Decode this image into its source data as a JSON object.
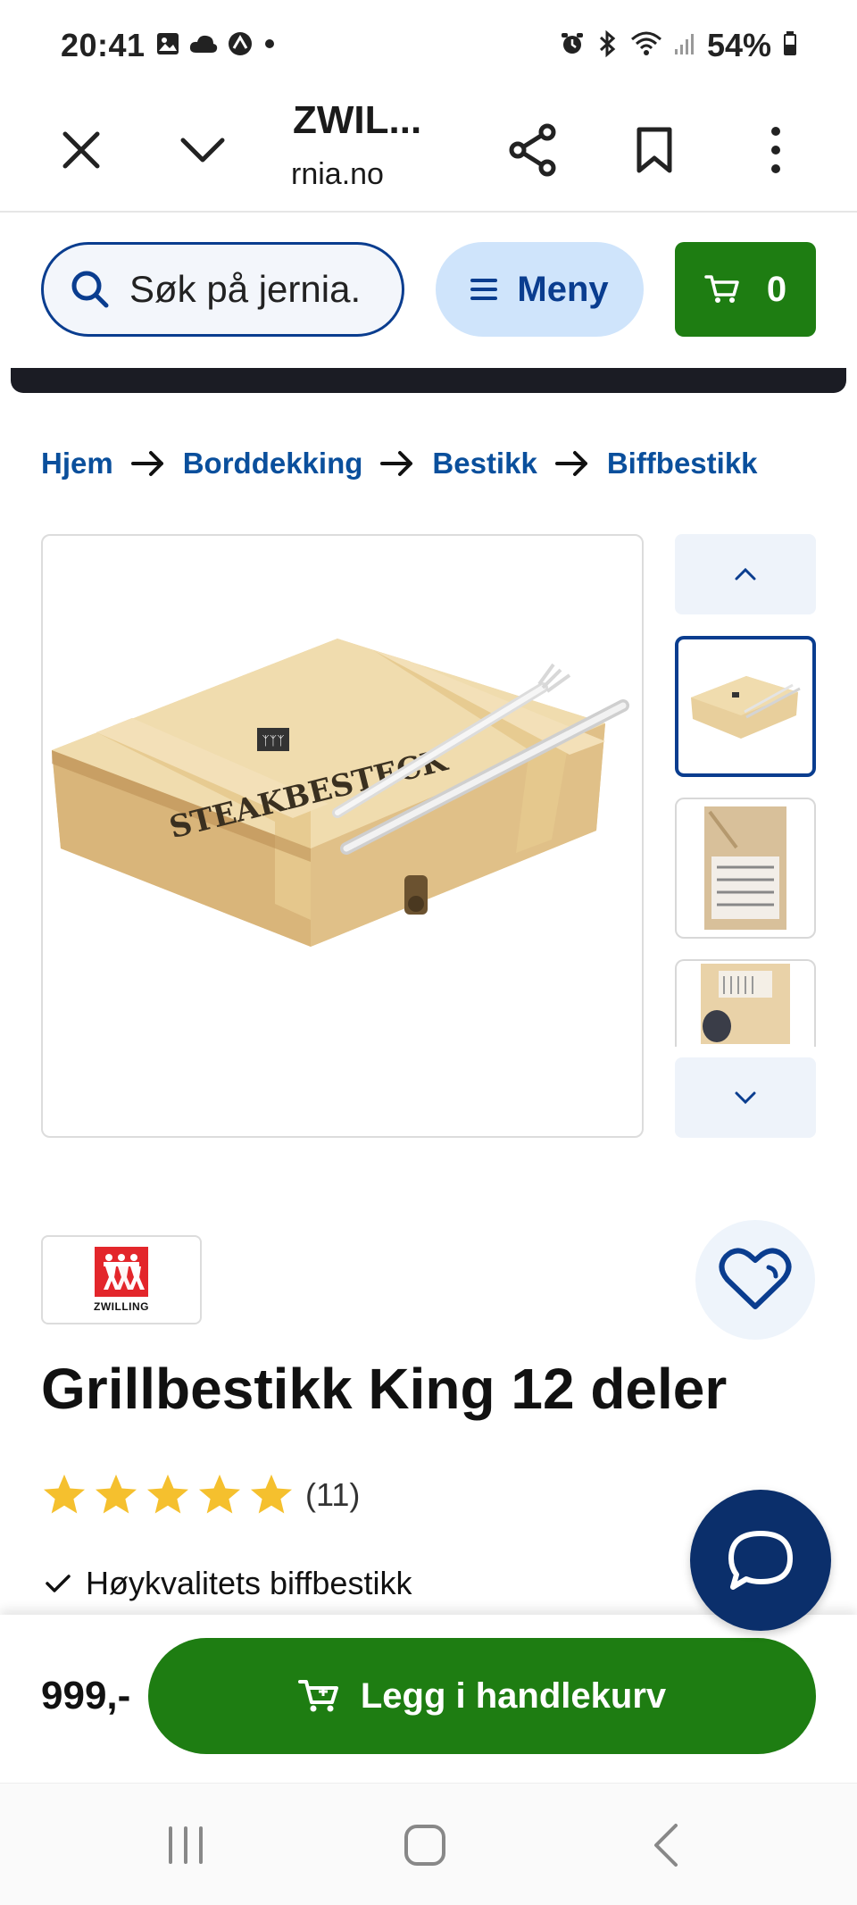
{
  "status_bar": {
    "time": "20:41",
    "battery": "54%",
    "icons_left": [
      "gallery-icon",
      "cloud-icon",
      "vpn-icon",
      "dot-icon"
    ],
    "icons_right": [
      "alarm-icon",
      "bluetooth-icon",
      "wifi-icon",
      "signal-icon",
      "battery-icon"
    ]
  },
  "browser": {
    "title": "ZWIL...",
    "url": "rnia.no",
    "buttons": [
      "close-icon",
      "chevron-down-icon",
      "share-icon",
      "bookmark-icon",
      "more-icon"
    ]
  },
  "header": {
    "search_placeholder": "Søk på jernia.",
    "menu_label": "Meny",
    "cart_count": "0"
  },
  "breadcrumb": [
    {
      "label": "Hjem"
    },
    {
      "label": "Borddekking"
    },
    {
      "label": "Bestikk"
    },
    {
      "label": "Biffbestikk"
    }
  ],
  "gallery": {
    "main_image_text": "STEAKBESTECK",
    "thumbnail_count": 3
  },
  "product": {
    "brand": "ZWILLING",
    "title": "Grillbestikk King 12 deler",
    "rating_stars": 5,
    "rating_count": "(11)",
    "feature": "Høykvalitets biffbestikk",
    "price": "999,-",
    "add_to_cart_label": "Legg i handlekurv"
  },
  "colors": {
    "brand_blue": "#0a3d8f",
    "link_blue": "#0a4f9c",
    "green": "#1e7d12",
    "light_blue": "#cfe4fb",
    "star": "#f5c02e",
    "zwilling_red": "#e3262b"
  }
}
